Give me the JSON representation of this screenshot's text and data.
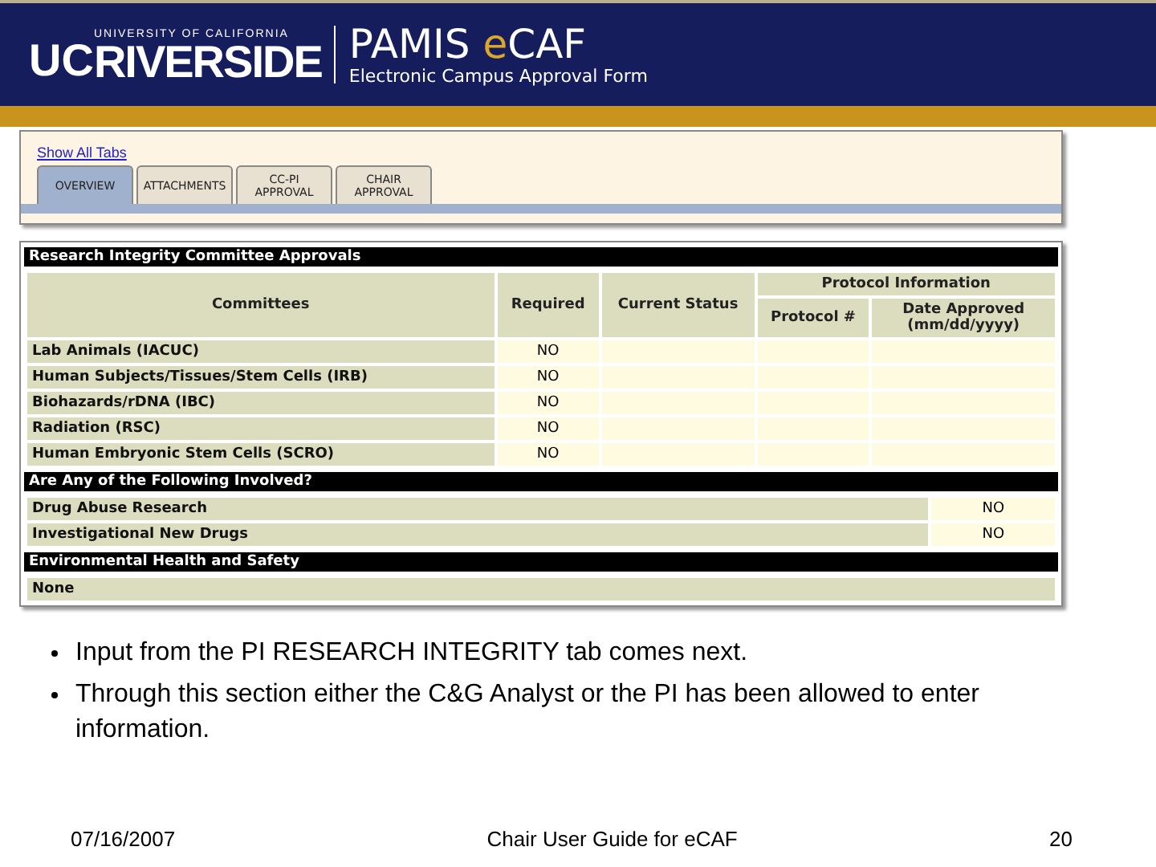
{
  "banner": {
    "logo_small": "UNIVERSITY OF CALIFORNIA",
    "logo_uc": "UC",
    "logo_main": "RIVERSIDE",
    "app_name_parts": [
      {
        "text": "PAMIS ",
        "accent": false
      },
      {
        "text": "e",
        "accent": true
      },
      {
        "text": "CAF",
        "accent": false
      }
    ],
    "app_subtitle": "Electronic Campus Approval Form"
  },
  "screen": {
    "show_all_link": "Show All Tabs",
    "tabs": [
      {
        "label": "OVERVIEW",
        "selected": true
      },
      {
        "label": "ATTACHMENTS",
        "selected": false
      },
      {
        "label": "CC-PI APPROVAL",
        "selected": false
      },
      {
        "label": "CHAIR APPROVAL",
        "selected": false
      }
    ],
    "committee_section": {
      "title": "Research Integrity Committee Approvals",
      "columns": {
        "committees": "Committees",
        "required": "Required",
        "status": "Current Status",
        "group": "Protocol Information",
        "protocol": "Protocol #",
        "date": "Date Approved (mm/dd/yyyy)"
      },
      "rows": [
        {
          "name": "Lab Animals (IACUC)",
          "required": "NO"
        },
        {
          "name": "Human Subjects/Tissues/Stem Cells (IRB)",
          "required": "NO"
        },
        {
          "name": "Biohazards/rDNA (IBC)",
          "required": "NO"
        },
        {
          "name": "Radiation (RSC)",
          "required": "NO"
        },
        {
          "name": "Human Embryonic Stem Cells (SCRO)",
          "required": "NO"
        }
      ]
    },
    "involved_section": {
      "title": "Are Any of the Following Involved?",
      "rows": [
        {
          "name": "Drug Abuse Research",
          "value": "NO"
        },
        {
          "name": "Investigational New Drugs",
          "value": "NO"
        }
      ]
    },
    "ehs_section": {
      "title": "Environmental Health and Safety",
      "value": "None"
    }
  },
  "bullets": [
    "Input from the PI RESEARCH INTEGRITY tab comes next.",
    "Through this section either the C&G Analyst or the PI has been allowed to enter information."
  ],
  "footer": {
    "date": "07/16/2007",
    "title": "Chair User Guide for eCAF",
    "page": "20"
  }
}
